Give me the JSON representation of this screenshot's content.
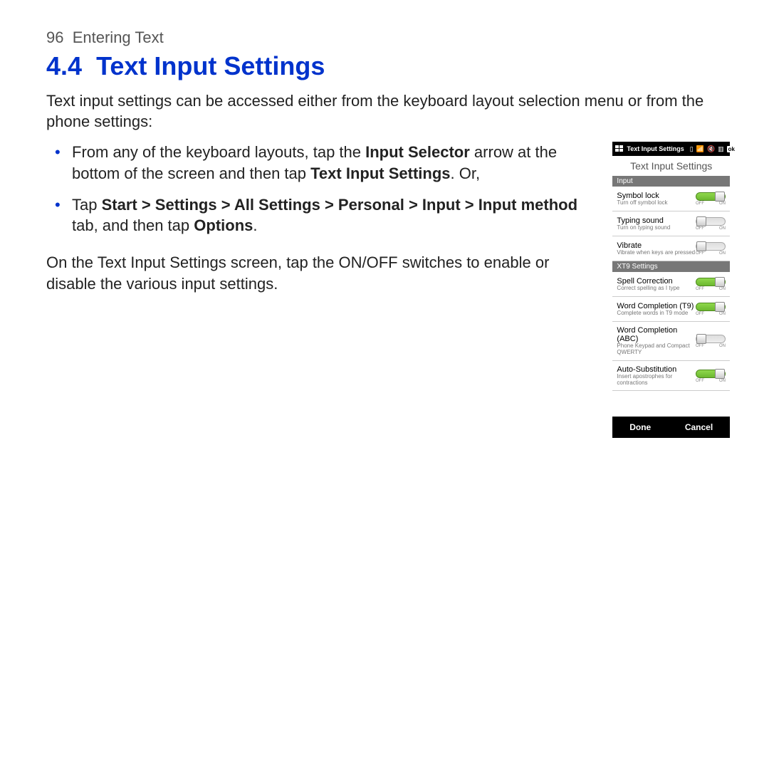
{
  "header": {
    "page_number": "96",
    "chapter_title": "Entering Text"
  },
  "section": {
    "number": "4.4",
    "title": "Text Input Settings"
  },
  "intro": "Text input settings can be accessed either from the keyboard layout selection menu or from the phone settings:",
  "bullets": {
    "b1": {
      "t1": "From any of the keyboard layouts, tap the ",
      "bold1": "Input Selector",
      "t2": " arrow at the bottom of the screen and then tap ",
      "bold2": "Text Input Settings",
      "t3": ". Or,"
    },
    "b2": {
      "t1": "Tap ",
      "bold1": "Start > Settings > All Settings > Personal > Input > Input method",
      "t2": " tab, and then tap ",
      "bold2": "Options",
      "t3": "."
    }
  },
  "after_list": "On the Text Input Settings screen, tap the ON/OFF switches to enable or disable the various input settings.",
  "phone": {
    "status_title": "Text Input Settings",
    "ok": "ok",
    "screen_title": "Text Input Settings",
    "sections": {
      "input": "Input",
      "xt9": "XT9 Settings"
    },
    "rows": [
      {
        "title": "Symbol lock",
        "desc": "Turn off symbol lock",
        "on": true
      },
      {
        "title": "Typing sound",
        "desc": "Turn on typing sound",
        "on": false
      },
      {
        "title": "Vibrate",
        "desc": "Vibrate when keys are pressed",
        "on": false
      },
      {
        "title": "Spell Correction",
        "desc": "Correct spelling as I type",
        "on": true
      },
      {
        "title": "Word Completion (T9)",
        "desc": "Complete words in T9 mode",
        "on": true
      },
      {
        "title": "Word Completion (ABC)",
        "desc": "Phone Keypad and Compact QWERTY",
        "on": false
      },
      {
        "title": "Auto-Substitution",
        "desc": "Insert apostrophes for contractions",
        "on": true
      }
    ],
    "toggle": {
      "off": "OFF",
      "on": "ON"
    },
    "softkeys": {
      "left": "Done",
      "right": "Cancel"
    }
  }
}
